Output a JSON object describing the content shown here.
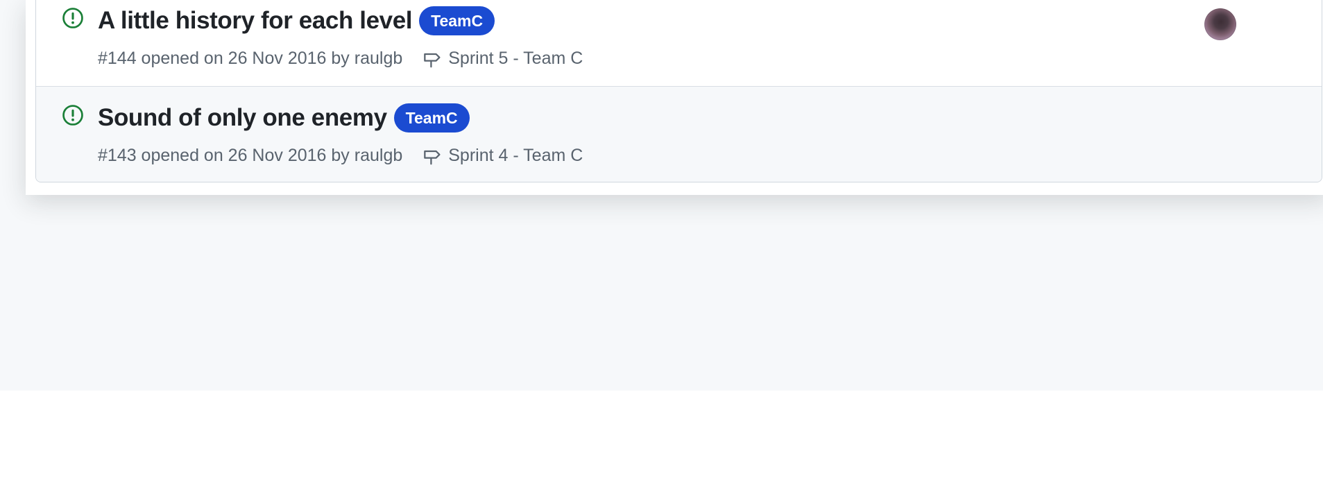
{
  "colors": {
    "open_issue": "#1a7f37",
    "label_teamc": "#1b4bd1",
    "meta_text": "#59636e",
    "title_text": "#1f2328"
  },
  "issues": [
    {
      "title": "A little history for each level",
      "label": "TeamC",
      "meta": "#144 opened on 26 Nov 2016 by raulgb",
      "milestone": "Sprint 5 - Team C",
      "status_icon": "issue-opened-icon",
      "has_assignee_avatar": true
    },
    {
      "title": "Sound of only one enemy",
      "label": "TeamC",
      "meta": "#143 opened on 26 Nov 2016 by raulgb",
      "milestone": "Sprint 4 - Team C",
      "status_icon": "issue-opened-icon",
      "has_assignee_avatar": false
    }
  ]
}
